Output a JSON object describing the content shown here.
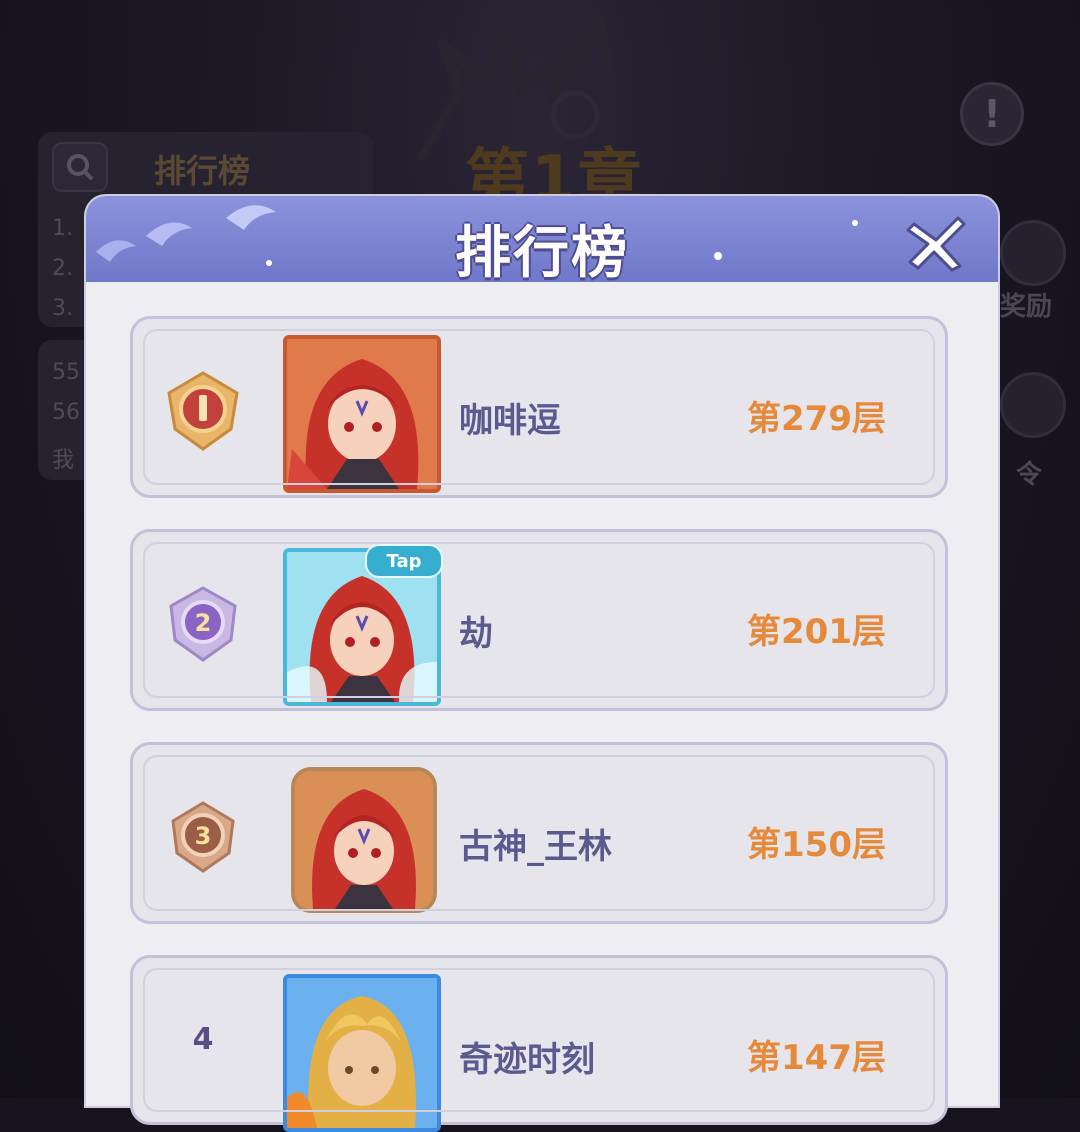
{
  "background": {
    "panel_title": "排行榜",
    "chapter_title": "第1章",
    "list_lines": [
      "1.",
      "2.",
      "3."
    ],
    "list_lines_2": [
      "55",
      "56",
      "我"
    ],
    "right_labels": [
      "奖励",
      "令"
    ]
  },
  "modal": {
    "title": "排行榜",
    "header_color": "#7c84d3",
    "close_icon": "close-x-icon"
  },
  "rankings": [
    {
      "rank": "1",
      "name": "咖啡逗",
      "floor": "第279层",
      "badge": "gold-medal-1",
      "frame": "red"
    },
    {
      "rank": "2",
      "name": "劫",
      "floor": "第201层",
      "badge": "silver-medal-2",
      "frame": "blue",
      "tag": "Tap"
    },
    {
      "rank": "3",
      "name": "古神_王林",
      "floor": "第150层",
      "badge": "bronze-medal-3",
      "frame": "brown"
    },
    {
      "rank": "4",
      "name": "奇迹时刻",
      "floor": "第147层",
      "frame": "gold"
    }
  ],
  "colors": {
    "name": "#5a5a8e",
    "floor": "#e58a3b",
    "row_border": "#c4c0d8"
  }
}
